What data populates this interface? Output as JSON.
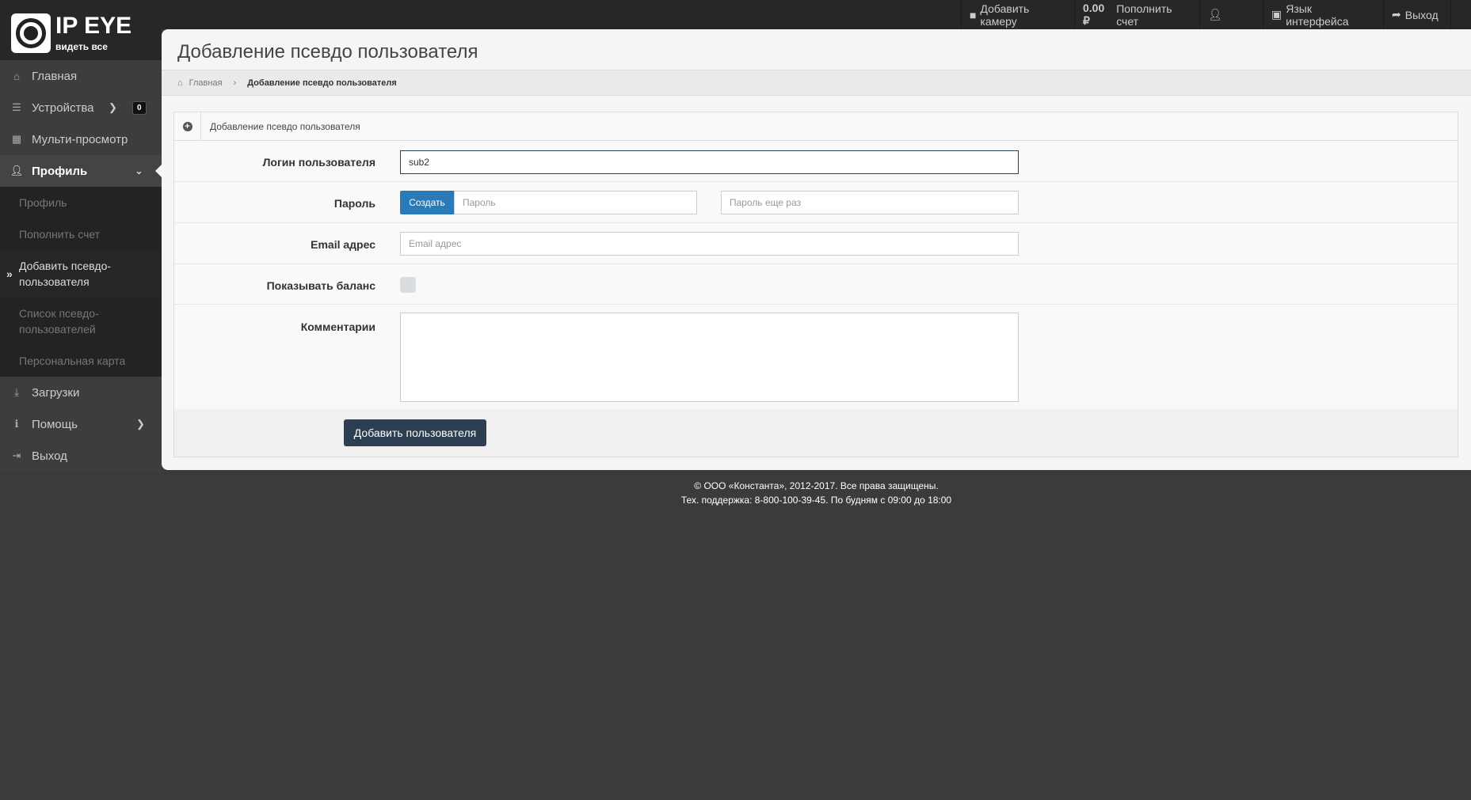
{
  "logo": {
    "title": "IP EYE",
    "tagline": "видеть все"
  },
  "topbar": {
    "add_camera": "Добавить камеру",
    "balance": "0.00 ₽",
    "top_up": "Пополнить счет",
    "language": "Язык интерфейса",
    "logout": "Выход"
  },
  "sidebar": {
    "items": [
      {
        "label": "Главная"
      },
      {
        "label": "Устройства",
        "badge": "0"
      },
      {
        "label": "Мульти-просмотр"
      },
      {
        "label": "Профиль"
      },
      {
        "label": "Загрузки"
      },
      {
        "label": "Помощь"
      },
      {
        "label": "Выход"
      }
    ],
    "submenu": [
      "Профиль",
      "Пополнить счет",
      "Добавить псевдо-пользователя",
      "Список псевдо-пользователей",
      "Персональная карта"
    ]
  },
  "page": {
    "title": "Добавление псевдо пользователя",
    "breadcrumb": {
      "home": "Главная",
      "current": "Добавление псевдо пользователя"
    }
  },
  "form": {
    "header": "Добавление псевдо пользователя",
    "login_label": "Логин пользователя",
    "login_value": "sub2",
    "password_label": "Пароль",
    "create_button": "Создать",
    "password_placeholder": "Пароль",
    "password_repeat_placeholder": "Пароль еще раз",
    "email_label": "Email адрес",
    "email_placeholder": "Email адрес",
    "balance_label": "Показывать баланс",
    "balance_checked": false,
    "comments_label": "Комментарии",
    "submit": "Добавить пользователя"
  },
  "footer": {
    "line1": "© ООО «Константа», 2012-2017. Все права защищены.",
    "line2": "Тех. поддержка: 8-800-100-39-45. По будням с 09:00 до 18:00"
  }
}
